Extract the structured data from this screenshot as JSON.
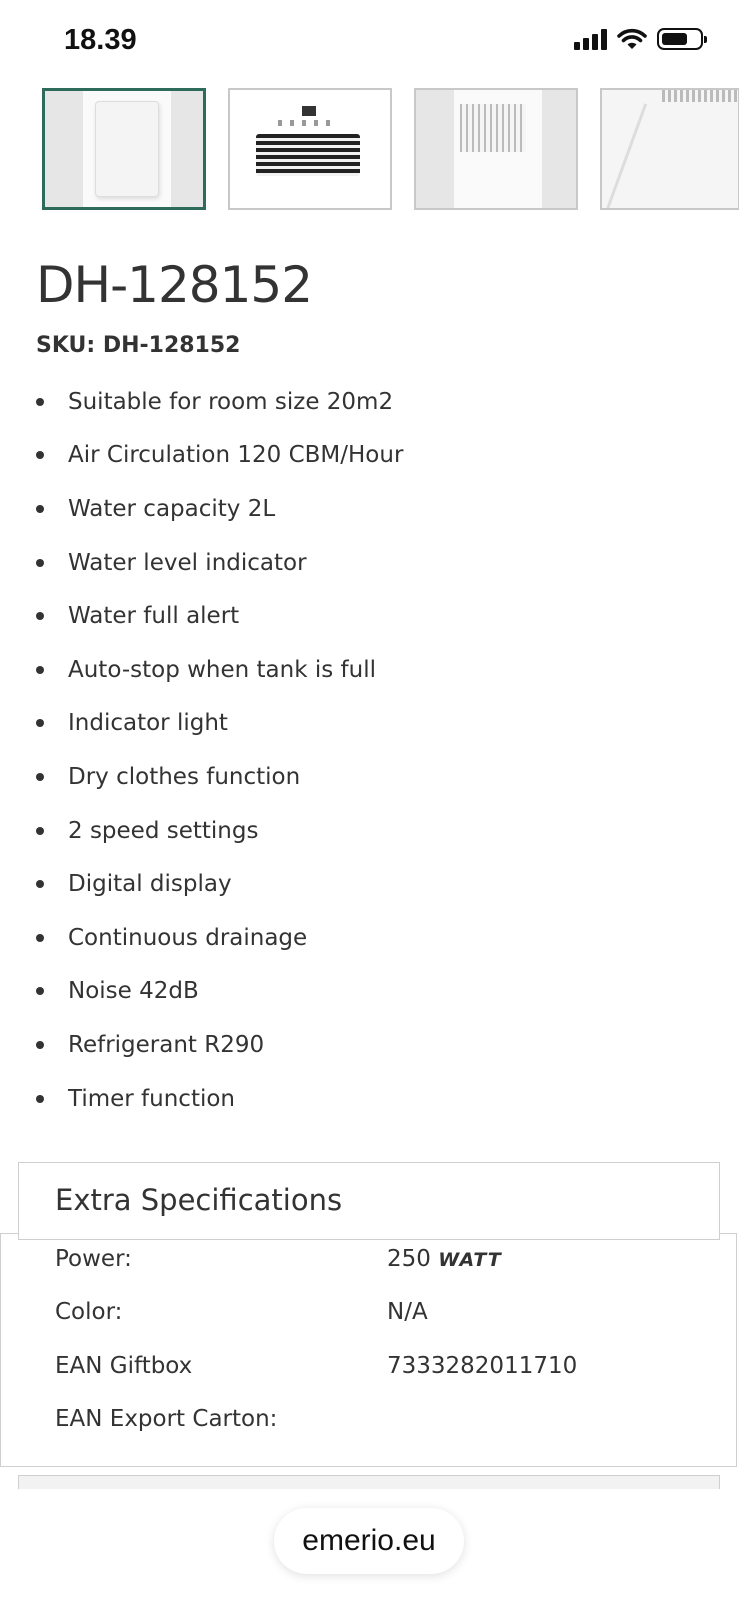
{
  "status_bar": {
    "time": "18.39",
    "signal_icon": "cellular-signal-icon",
    "wifi_icon": "wifi-icon",
    "battery_icon": "battery-icon",
    "battery_level": 0.7
  },
  "gallery": {
    "selected_index": 0,
    "accent_color": "#2f6b5a",
    "thumbnails": [
      {
        "alt": "front-view"
      },
      {
        "alt": "control-panel-view"
      },
      {
        "alt": "back-view"
      },
      {
        "alt": "drain-hose-view"
      }
    ]
  },
  "product": {
    "title": "DH-128152",
    "sku": "SKU: DH-128152",
    "features": [
      "Suitable for room size 20m2",
      "Air Circulation 120 CBM/Hour",
      "Water capacity 2L",
      "Water level indicator",
      "Water full alert",
      "Auto-stop when tank is full",
      "Indicator light",
      "Dry clothes function",
      "2 speed settings",
      "Digital display",
      "Continuous drainage",
      "Noise 42dB",
      "Refrigerant R290",
      "Timer function"
    ]
  },
  "specs": {
    "title": "Extra Specifications",
    "rows": [
      {
        "label": "Power:",
        "value": "250",
        "unit": "WATT"
      },
      {
        "label": "Color:",
        "value": "N/A",
        "unit": ""
      },
      {
        "label": "EAN Giftbox",
        "value": "7333282011710",
        "unit": ""
      },
      {
        "label": "EAN Export Carton:",
        "value": "",
        "unit": ""
      }
    ]
  },
  "browser": {
    "url": "emerio.eu"
  }
}
